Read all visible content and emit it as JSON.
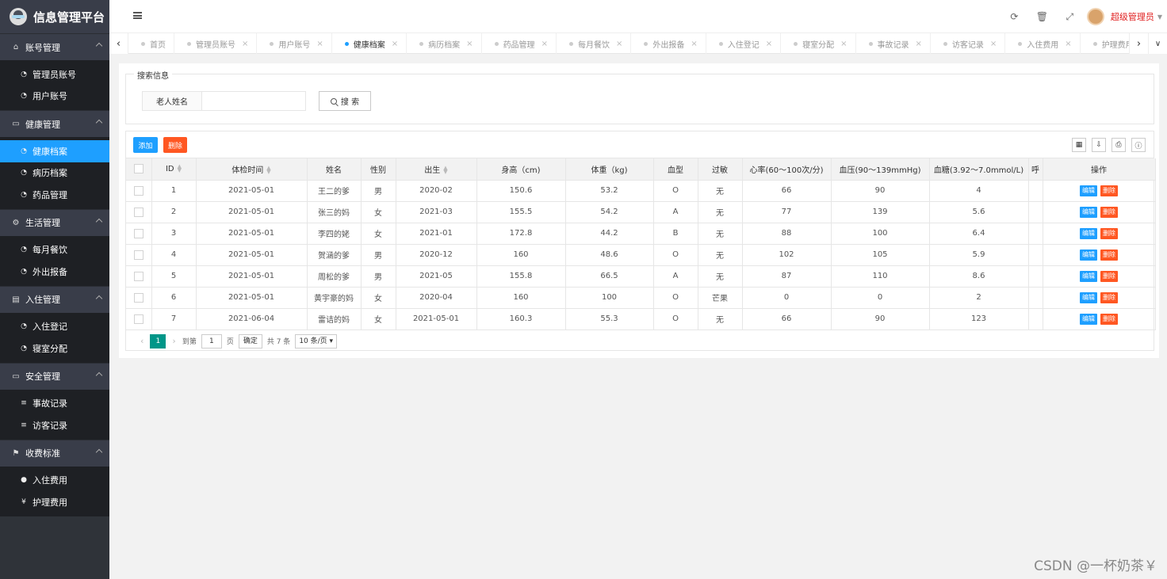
{
  "app": {
    "title": "信息管理平台"
  },
  "sidebar": {
    "groups": [
      {
        "title": "账号管理",
        "icon": "home-icon",
        "items": [
          {
            "label": "管理员账号",
            "icon": "dashboard-icon"
          },
          {
            "label": "用户账号",
            "icon": "dashboard-icon"
          }
        ]
      },
      {
        "title": "健康管理",
        "icon": "calendar-icon",
        "items": [
          {
            "label": "健康档案",
            "icon": "dashboard-icon"
          },
          {
            "label": "病历档案",
            "icon": "dashboard-icon"
          },
          {
            "label": "药品管理",
            "icon": "dashboard-icon"
          }
        ]
      },
      {
        "title": "生活管理",
        "icon": "gears-icon",
        "items": [
          {
            "label": "每月餐饮",
            "icon": "dashboard-icon"
          },
          {
            "label": "外出报备",
            "icon": "dashboard-icon"
          }
        ]
      },
      {
        "title": "入住管理",
        "icon": "file-icon",
        "items": [
          {
            "label": "入住登记",
            "icon": "dashboard-icon"
          },
          {
            "label": "寝室分配",
            "icon": "dashboard-icon"
          }
        ]
      },
      {
        "title": "安全管理",
        "icon": "calendar-icon",
        "items": [
          {
            "label": "事故记录",
            "icon": "list-icon"
          },
          {
            "label": "访客记录",
            "icon": "list-icon"
          }
        ]
      },
      {
        "title": "收费标准",
        "icon": "flag-icon",
        "items": [
          {
            "label": "入住费用",
            "icon": "coin-icon"
          },
          {
            "label": "护理费用",
            "icon": "yen-icon"
          }
        ]
      }
    ],
    "active": "健康档案"
  },
  "header": {
    "user_name": "超级管理员",
    "icons": [
      "refresh-icon",
      "trash-icon",
      "fullscreen-icon"
    ]
  },
  "tabs": [
    {
      "label": "首页",
      "active": false
    },
    {
      "label": "管理员账号",
      "active": false
    },
    {
      "label": "用户账号",
      "active": false
    },
    {
      "label": "健康档案",
      "active": true
    },
    {
      "label": "病历档案",
      "active": false
    },
    {
      "label": "药品管理",
      "active": false
    },
    {
      "label": "每月餐饮",
      "active": false
    },
    {
      "label": "外出报备",
      "active": false
    },
    {
      "label": "入住登记",
      "active": false
    },
    {
      "label": "寝室分配",
      "active": false
    },
    {
      "label": "事故记录",
      "active": false
    },
    {
      "label": "访客记录",
      "active": false
    },
    {
      "label": "入住费用",
      "active": false
    },
    {
      "label": "护理费用",
      "active": false
    }
  ],
  "search": {
    "legend": "搜索信息",
    "label": "老人姓名",
    "value": "",
    "placeholder": "",
    "button": "搜 索"
  },
  "toolbar": {
    "add": "添加",
    "delete": "删除"
  },
  "table": {
    "columns": [
      "ID",
      "体检时间",
      "姓名",
      "性别",
      "出生",
      "身高（cm)",
      "体重（kg)",
      "血型",
      "过敏",
      "心率(60～100次/分)",
      "血压(90～139mmHg)",
      "血糖(3.92～7.0mmol/L)",
      "呼",
      "操作"
    ],
    "rows": [
      [
        "1",
        "2021-05-01",
        "王二的爹",
        "男",
        "2020-02",
        "150.6",
        "53.2",
        "O",
        "无",
        "66",
        "90",
        "4",
        ""
      ],
      [
        "2",
        "2021-05-01",
        "张三的妈",
        "女",
        "2021-03",
        "155.5",
        "54.2",
        "A",
        "无",
        "77",
        "139",
        "5.6",
        ""
      ],
      [
        "3",
        "2021-05-01",
        "李四的姥",
        "女",
        "2021-01",
        "172.8",
        "44.2",
        "B",
        "无",
        "88",
        "100",
        "6.4",
        ""
      ],
      [
        "4",
        "2021-05-01",
        "贺涵的爹",
        "男",
        "2020-12",
        "160",
        "48.6",
        "O",
        "无",
        "102",
        "105",
        "5.9",
        ""
      ],
      [
        "5",
        "2021-05-01",
        "周松的爹",
        "男",
        "2021-05",
        "155.8",
        "66.5",
        "A",
        "无",
        "87",
        "110",
        "8.6",
        ""
      ],
      [
        "6",
        "2021-05-01",
        "黄宇豪的妈",
        "女",
        "2020-04",
        "160",
        "100",
        "O",
        "芒果",
        "0",
        "0",
        "2",
        ""
      ],
      [
        "7",
        "2021-06-04",
        "雷诘的妈",
        "女",
        "2021-05-01",
        "160.3",
        "55.3",
        "O",
        "无",
        "66",
        "90",
        "123",
        ""
      ]
    ],
    "edit_label": "编辑",
    "delete_label": "删除"
  },
  "pager": {
    "current": "1",
    "goto_label": "到第",
    "goto_value": "1",
    "page_unit": "页",
    "confirm": "确定",
    "total": "共 7 条",
    "page_size": "10 条/页"
  },
  "watermark": "CSDN @一杯奶茶￥"
}
